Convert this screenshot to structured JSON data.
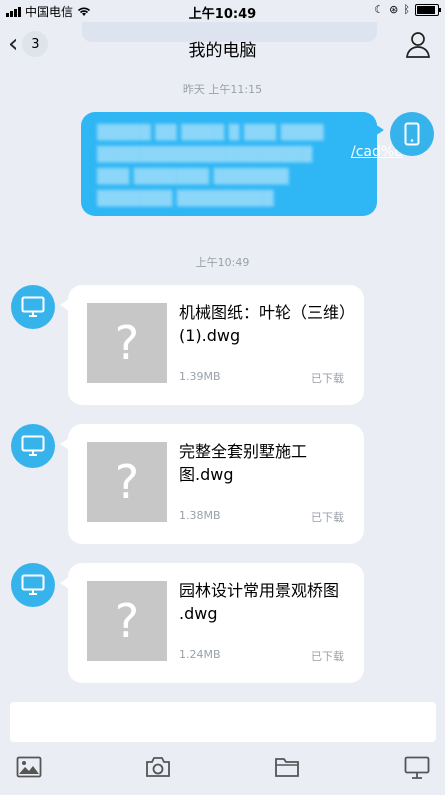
{
  "status_bar": {
    "carrier": "中国电信",
    "time": "上午10:49"
  },
  "nav": {
    "back_count": "3",
    "title": "我的电脑"
  },
  "messages": {
    "ts1": "昨天 上午11:15",
    "link_fragment": "/cad%E",
    "ts2": "上午10:49",
    "files": [
      {
        "name": "机械图纸：叶轮（三维）(1).dwg",
        "size": "1.39MB",
        "status": "已下载"
      },
      {
        "name": "完整全套别墅施工图.dwg",
        "size": "1.38MB",
        "status": "已下载"
      },
      {
        "name": "园林设计常用景观桥图 .dwg",
        "size": "1.24MB",
        "status": "已下载"
      }
    ]
  },
  "toolbar": {
    "icons": [
      "image-icon",
      "camera-icon",
      "folder-icon",
      "computer-icon"
    ]
  },
  "colors": {
    "accent": "#2fb6f4",
    "background": "#eaedf4",
    "avatar": "#37b3ec"
  }
}
